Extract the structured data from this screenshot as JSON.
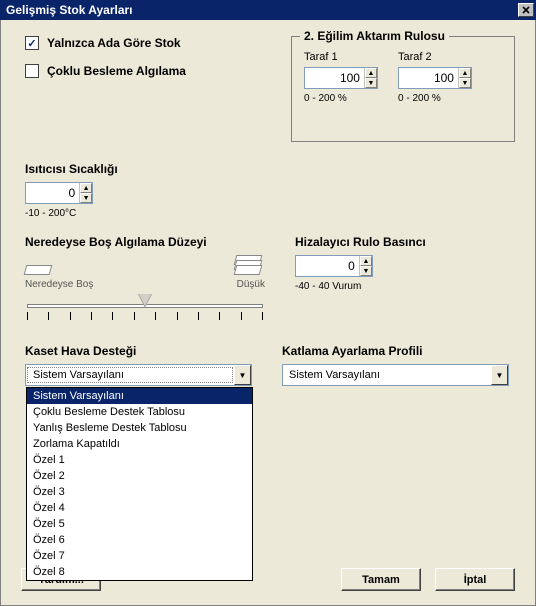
{
  "title": "Gelişmiş Stok Ayarları",
  "checks": {
    "only_by_name": {
      "label": "Yalnızca Ada Göre Stok",
      "checked": true
    },
    "multi_feed": {
      "label": "Çoklu Besleme Algılama",
      "checked": false
    }
  },
  "group": {
    "legend": "2. Eğilim Aktarım Rulosu",
    "side1": {
      "label": "Taraf 1",
      "value": "100",
      "caption": "0 - 200 %"
    },
    "side2": {
      "label": "Taraf 2",
      "value": "100",
      "caption": "0 - 200 %"
    }
  },
  "heater": {
    "label": "Isıtıcısı Sıcaklığı",
    "value": "0",
    "caption": "-10 - 200°C"
  },
  "near_empty": {
    "label": "Neredeyse Boş Algılama Düzeyi",
    "left_caption": "Neredeyse Boş",
    "right_caption": "Düşük"
  },
  "aligner": {
    "label": "Hizalayıcı Rulo Basıncı",
    "value": "0",
    "caption": "-40 - 40 Vurum"
  },
  "tray_air": {
    "label": "Kaset Hava Desteği",
    "value": "Sistem Varsayılanı",
    "options": [
      "Sistem Varsayılanı",
      "Çoklu Besleme Destek Tablosu",
      "Yanlış Besleme Destek Tablosu",
      "Zorlama Kapatıldı",
      "Özel 1",
      "Özel 2",
      "Özel 3",
      "Özel 4",
      "Özel 5",
      "Özel 6",
      "Özel 7",
      "Özel 8"
    ]
  },
  "fold_profile": {
    "label": "Katlama Ayarlama Profili",
    "value": "Sistem Varsayılanı"
  },
  "buttons": {
    "help": "Yardım...",
    "ok": "Tamam",
    "cancel": "İptal"
  }
}
